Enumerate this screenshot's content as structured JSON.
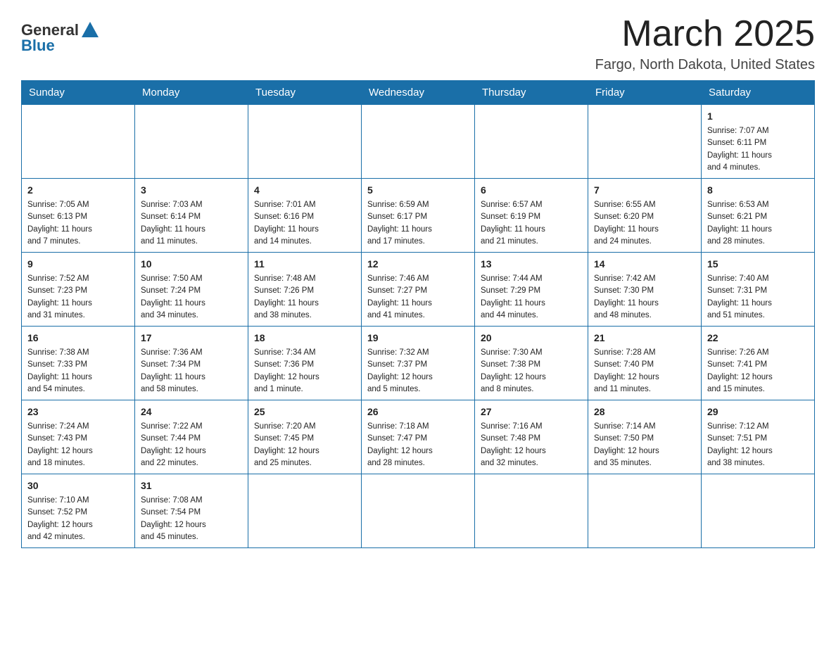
{
  "header": {
    "logo": {
      "general": "General",
      "blue": "Blue"
    },
    "title": "March 2025",
    "location": "Fargo, North Dakota, United States"
  },
  "days_of_week": [
    "Sunday",
    "Monday",
    "Tuesday",
    "Wednesday",
    "Thursday",
    "Friday",
    "Saturday"
  ],
  "weeks": [
    [
      {
        "day": null,
        "info": null
      },
      {
        "day": null,
        "info": null
      },
      {
        "day": null,
        "info": null
      },
      {
        "day": null,
        "info": null
      },
      {
        "day": null,
        "info": null
      },
      {
        "day": null,
        "info": null
      },
      {
        "day": "1",
        "info": "Sunrise: 7:07 AM\nSunset: 6:11 PM\nDaylight: 11 hours\nand 4 minutes."
      }
    ],
    [
      {
        "day": "2",
        "info": "Sunrise: 7:05 AM\nSunset: 6:13 PM\nDaylight: 11 hours\nand 7 minutes."
      },
      {
        "day": "3",
        "info": "Sunrise: 7:03 AM\nSunset: 6:14 PM\nDaylight: 11 hours\nand 11 minutes."
      },
      {
        "day": "4",
        "info": "Sunrise: 7:01 AM\nSunset: 6:16 PM\nDaylight: 11 hours\nand 14 minutes."
      },
      {
        "day": "5",
        "info": "Sunrise: 6:59 AM\nSunset: 6:17 PM\nDaylight: 11 hours\nand 17 minutes."
      },
      {
        "day": "6",
        "info": "Sunrise: 6:57 AM\nSunset: 6:19 PM\nDaylight: 11 hours\nand 21 minutes."
      },
      {
        "day": "7",
        "info": "Sunrise: 6:55 AM\nSunset: 6:20 PM\nDaylight: 11 hours\nand 24 minutes."
      },
      {
        "day": "8",
        "info": "Sunrise: 6:53 AM\nSunset: 6:21 PM\nDaylight: 11 hours\nand 28 minutes."
      }
    ],
    [
      {
        "day": "9",
        "info": "Sunrise: 7:52 AM\nSunset: 7:23 PM\nDaylight: 11 hours\nand 31 minutes."
      },
      {
        "day": "10",
        "info": "Sunrise: 7:50 AM\nSunset: 7:24 PM\nDaylight: 11 hours\nand 34 minutes."
      },
      {
        "day": "11",
        "info": "Sunrise: 7:48 AM\nSunset: 7:26 PM\nDaylight: 11 hours\nand 38 minutes."
      },
      {
        "day": "12",
        "info": "Sunrise: 7:46 AM\nSunset: 7:27 PM\nDaylight: 11 hours\nand 41 minutes."
      },
      {
        "day": "13",
        "info": "Sunrise: 7:44 AM\nSunset: 7:29 PM\nDaylight: 11 hours\nand 44 minutes."
      },
      {
        "day": "14",
        "info": "Sunrise: 7:42 AM\nSunset: 7:30 PM\nDaylight: 11 hours\nand 48 minutes."
      },
      {
        "day": "15",
        "info": "Sunrise: 7:40 AM\nSunset: 7:31 PM\nDaylight: 11 hours\nand 51 minutes."
      }
    ],
    [
      {
        "day": "16",
        "info": "Sunrise: 7:38 AM\nSunset: 7:33 PM\nDaylight: 11 hours\nand 54 minutes."
      },
      {
        "day": "17",
        "info": "Sunrise: 7:36 AM\nSunset: 7:34 PM\nDaylight: 11 hours\nand 58 minutes."
      },
      {
        "day": "18",
        "info": "Sunrise: 7:34 AM\nSunset: 7:36 PM\nDaylight: 12 hours\nand 1 minute."
      },
      {
        "day": "19",
        "info": "Sunrise: 7:32 AM\nSunset: 7:37 PM\nDaylight: 12 hours\nand 5 minutes."
      },
      {
        "day": "20",
        "info": "Sunrise: 7:30 AM\nSunset: 7:38 PM\nDaylight: 12 hours\nand 8 minutes."
      },
      {
        "day": "21",
        "info": "Sunrise: 7:28 AM\nSunset: 7:40 PM\nDaylight: 12 hours\nand 11 minutes."
      },
      {
        "day": "22",
        "info": "Sunrise: 7:26 AM\nSunset: 7:41 PM\nDaylight: 12 hours\nand 15 minutes."
      }
    ],
    [
      {
        "day": "23",
        "info": "Sunrise: 7:24 AM\nSunset: 7:43 PM\nDaylight: 12 hours\nand 18 minutes."
      },
      {
        "day": "24",
        "info": "Sunrise: 7:22 AM\nSunset: 7:44 PM\nDaylight: 12 hours\nand 22 minutes."
      },
      {
        "day": "25",
        "info": "Sunrise: 7:20 AM\nSunset: 7:45 PM\nDaylight: 12 hours\nand 25 minutes."
      },
      {
        "day": "26",
        "info": "Sunrise: 7:18 AM\nSunset: 7:47 PM\nDaylight: 12 hours\nand 28 minutes."
      },
      {
        "day": "27",
        "info": "Sunrise: 7:16 AM\nSunset: 7:48 PM\nDaylight: 12 hours\nand 32 minutes."
      },
      {
        "day": "28",
        "info": "Sunrise: 7:14 AM\nSunset: 7:50 PM\nDaylight: 12 hours\nand 35 minutes."
      },
      {
        "day": "29",
        "info": "Sunrise: 7:12 AM\nSunset: 7:51 PM\nDaylight: 12 hours\nand 38 minutes."
      }
    ],
    [
      {
        "day": "30",
        "info": "Sunrise: 7:10 AM\nSunset: 7:52 PM\nDaylight: 12 hours\nand 42 minutes."
      },
      {
        "day": "31",
        "info": "Sunrise: 7:08 AM\nSunset: 7:54 PM\nDaylight: 12 hours\nand 45 minutes."
      },
      {
        "day": null,
        "info": null
      },
      {
        "day": null,
        "info": null
      },
      {
        "day": null,
        "info": null
      },
      {
        "day": null,
        "info": null
      },
      {
        "day": null,
        "info": null
      }
    ]
  ]
}
